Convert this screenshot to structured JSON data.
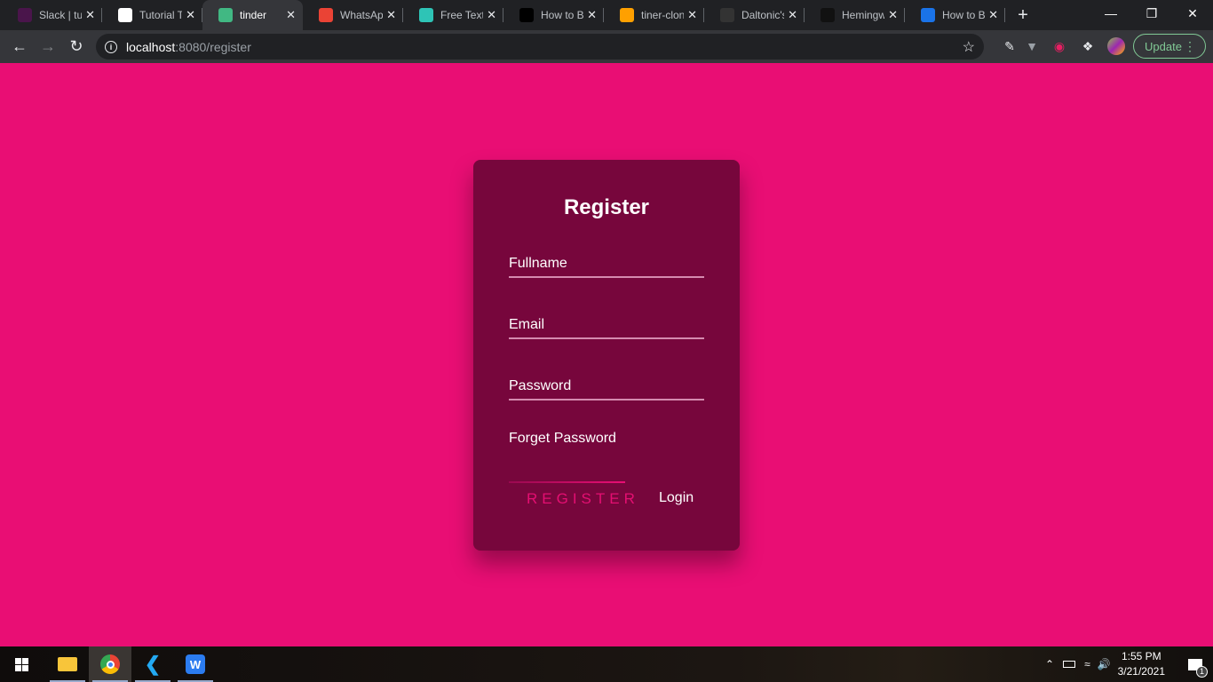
{
  "browser": {
    "tabs": [
      {
        "title": "Slack | tut",
        "icon": "slack-icon",
        "color": "#4a154b",
        "active": false
      },
      {
        "title": "Tutorial T",
        "icon": "globe-icon",
        "color": "#ffffff",
        "active": false
      },
      {
        "title": "tinder",
        "icon": "vue-icon",
        "color": "#41b883",
        "active": true
      },
      {
        "title": "WhatsApp",
        "icon": "alert-icon",
        "color": "#ea4335",
        "active": false
      },
      {
        "title": "Free Text",
        "icon": "n-logo-icon",
        "color": "#2ec4b6",
        "active": false
      },
      {
        "title": "How to B",
        "icon": "dev-icon",
        "color": "#000000",
        "active": false
      },
      {
        "title": "tiner-clon",
        "icon": "firebase-icon",
        "color": "#ffa000",
        "active": false
      },
      {
        "title": "Daltonic's",
        "icon": "github-icon",
        "color": "#333333",
        "active": false
      },
      {
        "title": "Hemingw",
        "icon": "hemingway-icon",
        "color": "#111111",
        "active": false
      },
      {
        "title": "How to B",
        "icon": "layers-icon",
        "color": "#1a73e8",
        "active": false
      }
    ],
    "url_host": "localhost",
    "url_path": ":8080/register",
    "update_label": "Update"
  },
  "form": {
    "title": "Register",
    "fullname_label": "Fullname",
    "email_label": "Email",
    "password_label": "Password",
    "forget_label": "Forget Password",
    "register_label": "REGISTER",
    "login_label": "Login"
  },
  "colors": {
    "background": "#e90e74",
    "card": "#77063c",
    "accent": "#e40f72"
  },
  "taskbar": {
    "time": "1:55 PM",
    "date": "3/21/2021",
    "notifications": "1"
  }
}
